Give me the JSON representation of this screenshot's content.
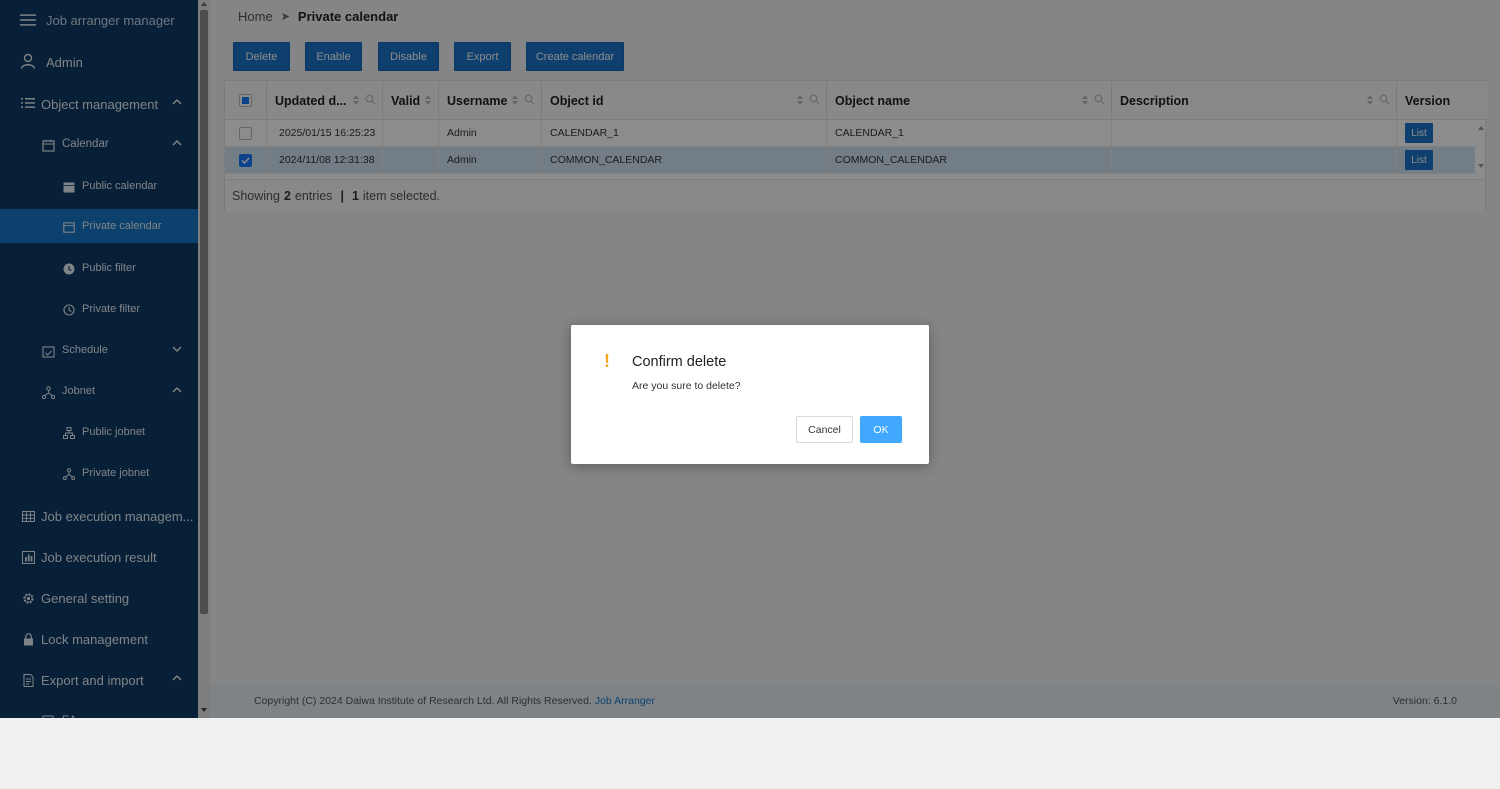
{
  "sidebar": {
    "app_title": "Job arranger manager",
    "user": "Admin",
    "items": [
      {
        "label": "Object management",
        "icon": "list-icon"
      },
      {
        "label": "Calendar",
        "icon": "calendar-icon"
      },
      {
        "label": "Public calendar",
        "icon": "calendar-filled-icon"
      },
      {
        "label": "Private calendar",
        "icon": "calendar-icon"
      },
      {
        "label": "Public filter",
        "icon": "clock-filled-icon"
      },
      {
        "label": "Private filter",
        "icon": "clock-icon"
      },
      {
        "label": "Schedule",
        "icon": "schedule-icon"
      },
      {
        "label": "Jobnet",
        "icon": "jobnet-icon"
      },
      {
        "label": "Public jobnet",
        "icon": "jobnet-public-icon"
      },
      {
        "label": "Private jobnet",
        "icon": "jobnet-icon"
      },
      {
        "label": "Job execution managem...",
        "icon": "table-icon"
      },
      {
        "label": "Job execution result",
        "icon": "chart-icon"
      },
      {
        "label": "General setting",
        "icon": "gear-icon"
      },
      {
        "label": "Lock management",
        "icon": "lock-icon"
      },
      {
        "label": "Export and import",
        "icon": "file-icon"
      },
      {
        "label": "EA",
        "icon": "file-icon"
      }
    ]
  },
  "breadcrumb": {
    "home": "Home",
    "separator": "➤",
    "current": "Private calendar"
  },
  "toolbar": {
    "delete": "Delete",
    "enable": "Enable",
    "disable": "Disable",
    "export": "Export",
    "create": "Create calendar"
  },
  "table": {
    "columns": [
      "Updated d...",
      "Valid",
      "Username",
      "Object id",
      "Object name",
      "Description",
      "Version"
    ],
    "rows": [
      {
        "updated": "2025/01/15 16:25:23",
        "valid": "",
        "username": "Admin",
        "object_id": "CALENDAR_1",
        "object_name": "CALENDAR_1",
        "description": "",
        "version": "List",
        "selected": false
      },
      {
        "updated": "2024/11/08 12:31:38",
        "valid": "",
        "username": "Admin",
        "object_id": "COMMON_CALENDAR",
        "object_name": "COMMON_CALENDAR",
        "description": "",
        "version": "List",
        "selected": true
      }
    ],
    "footer": {
      "showing": "Showing",
      "count": "2",
      "entries": "entries",
      "sep": "|",
      "selected_count": "1",
      "selected_text": "item selected."
    }
  },
  "footer": {
    "copyright": "Copyright (C) 2024 Daiwa Institute of Research Ltd. All Rights Reserved.",
    "link": "Job Arranger",
    "version": "Version: 6.1.0"
  },
  "dialog": {
    "icon": "!",
    "title": "Confirm delete",
    "message": "Are you sure to delete?",
    "cancel": "Cancel",
    "ok": "OK"
  },
  "colors": {
    "sidebar": "#0d3b66",
    "active": "#1677c8",
    "primary": "#1a73c9",
    "ok": "#40a9ff",
    "warn": "#f5a623"
  }
}
